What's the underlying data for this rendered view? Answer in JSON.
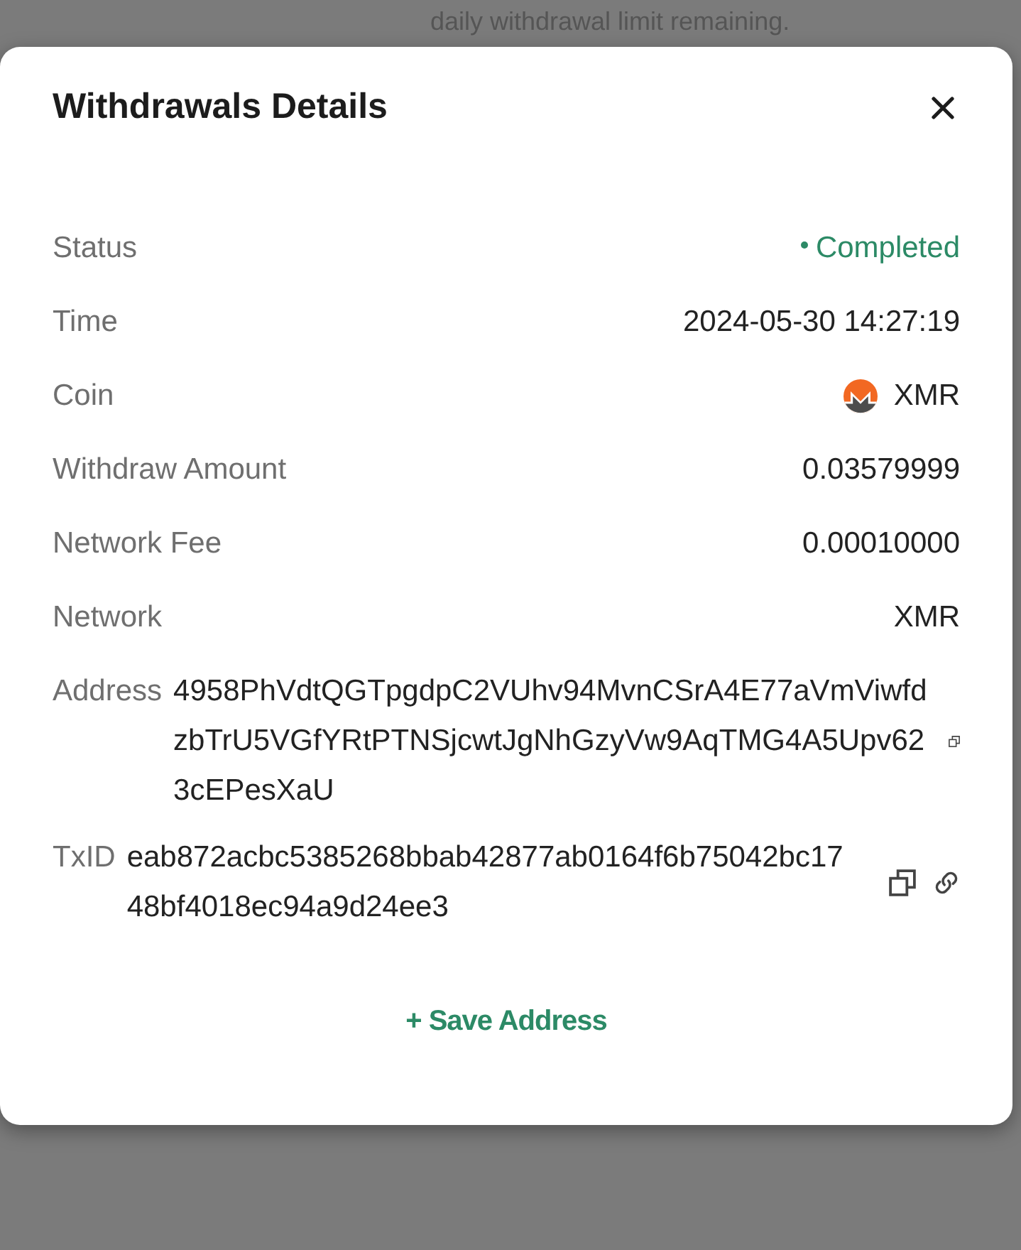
{
  "backdrop": {
    "text": "daily withdrawal limit remaining."
  },
  "dialog": {
    "title": "Withdrawals Details",
    "rows": [
      {
        "kind": "status",
        "label": "Status",
        "value": "Completed"
      },
      {
        "kind": "text",
        "label": "Time",
        "value": "2024-05-30 14:27:19"
      },
      {
        "kind": "coin",
        "label": "Coin",
        "value": "XMR"
      },
      {
        "kind": "text",
        "label": "Withdraw Amount",
        "value": "0.03579999"
      },
      {
        "kind": "text",
        "label": "Network Fee",
        "value": "0.00010000"
      },
      {
        "kind": "text",
        "label": "Network",
        "value": "XMR"
      }
    ],
    "hashes": [
      {
        "kind": "address",
        "label": "Address",
        "value": "4958PhVdtQGTpgdpC2VUhv94MvnCSrA4E77aVmViwfdzbTrU5VGfYRtPTNSjcwtJgNhGzyVw9AqTMG4A5Upv623cEPesXaU",
        "actions": [
          {
            "kind": "copy"
          }
        ]
      },
      {
        "kind": "txid",
        "label": "TxID",
        "value": "eab872acbc5385268bbab42877ab0164f6b75042bc1748bf4018ec94a9d24ee3",
        "actions": [
          {
            "kind": "copy"
          },
          {
            "kind": "link"
          }
        ]
      }
    ],
    "save_button": {
      "label": "+ Save Address"
    }
  }
}
